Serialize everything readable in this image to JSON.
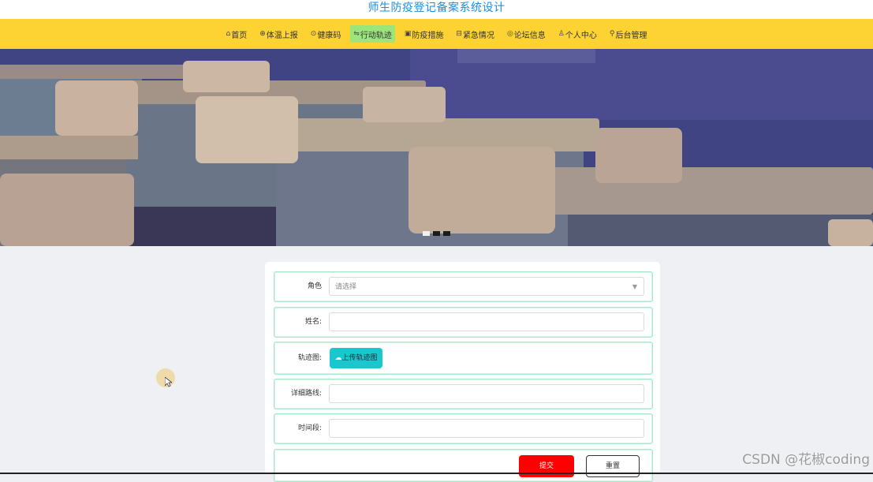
{
  "site": {
    "title": "师生防疫登记备案系统设计"
  },
  "nav": {
    "items": [
      {
        "icon": "home-icon",
        "glyph": "⌂",
        "label": "首页",
        "active": false
      },
      {
        "icon": "globe-icon",
        "glyph": "⊕",
        "label": "体温上报",
        "active": false
      },
      {
        "icon": "shield-icon",
        "glyph": "⊙",
        "label": "健康码",
        "active": false
      },
      {
        "icon": "route-icon",
        "glyph": "⇋",
        "label": "行动轨迹",
        "active": true
      },
      {
        "icon": "card-icon",
        "glyph": "▣",
        "label": "防疫措施",
        "active": false
      },
      {
        "icon": "alert-icon",
        "glyph": "⊟",
        "label": "紧急情况",
        "active": false
      },
      {
        "icon": "chat-icon",
        "glyph": "◎",
        "label": "论坛信息",
        "active": false
      },
      {
        "icon": "user-icon",
        "glyph": "♙",
        "label": "个人中心",
        "active": false
      },
      {
        "icon": "link-icon",
        "glyph": "⚲",
        "label": "后台管理",
        "active": false
      }
    ]
  },
  "banner": {
    "slide_count": 3,
    "active_slide": 1
  },
  "form": {
    "role": {
      "label": "角色",
      "placeholder": "请选择"
    },
    "name": {
      "label": "姓名:"
    },
    "track_image": {
      "label": "轨迹图:",
      "upload_label": "上传轨迹图"
    },
    "route_detail": {
      "label": "详细路线:"
    },
    "time_period": {
      "label": "时间段:"
    },
    "actions": {
      "submit_label": "提交",
      "reset_label": "重置"
    }
  },
  "watermark": "CSDN @花椒coding"
}
